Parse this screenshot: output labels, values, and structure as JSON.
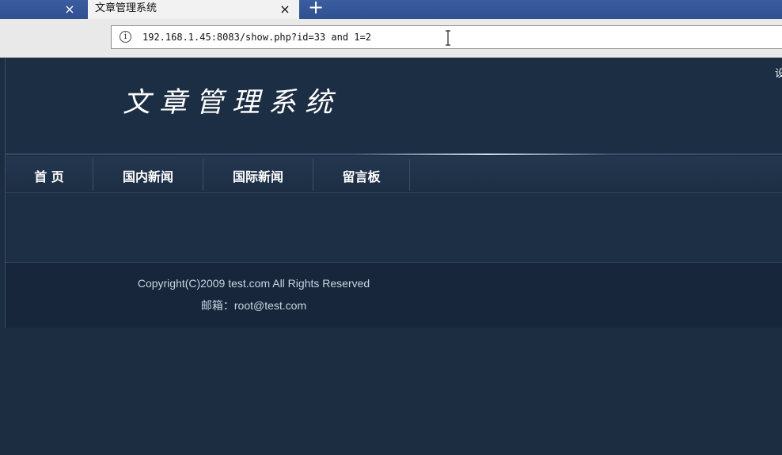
{
  "browser": {
    "prev_tab_close": "×",
    "active_tab": {
      "title": "文章管理系统",
      "close": "×"
    },
    "new_tab": "+",
    "address_bar": {
      "url": "192.168.1.45:8083/show.php?id=33 and 1=2"
    }
  },
  "site": {
    "title": "文章管理系统",
    "top_right": "设",
    "menu": [
      "首 页",
      "国内新闻",
      "国际新闻",
      "留言板"
    ],
    "footer": {
      "copyright": "Copyright(C)2009 test.com All Rights Reserved",
      "email": "邮箱：root@test.com"
    }
  },
  "colors": {
    "page_bg": "#1c2d42",
    "tabbar_bg": "#3b5da0",
    "menu_text": "#ffffff",
    "footer_text": "#c9d4e2"
  }
}
